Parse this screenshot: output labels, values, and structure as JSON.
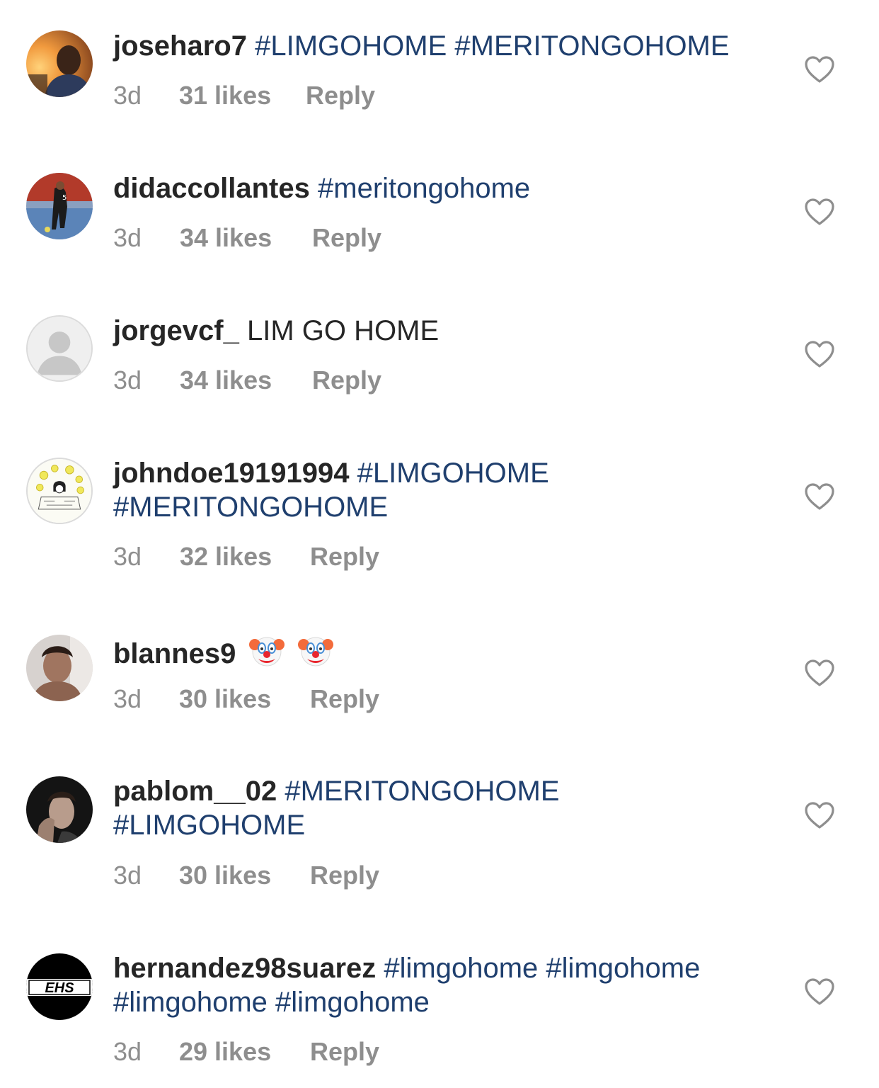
{
  "comments": [
    {
      "username": "joseharo7",
      "text_parts": [
        {
          "type": "hashtag",
          "text": "#LIMGOHOME"
        },
        {
          "type": "hashtag",
          "text": "#MERITONGOHOME"
        }
      ],
      "time": "3d",
      "likes": "31 likes",
      "reply": "Reply",
      "avatar": "avatar-sunset-portrait"
    },
    {
      "username": "didaccollantes",
      "text_parts": [
        {
          "type": "hashtag",
          "text": "#meritongohome"
        }
      ],
      "time": "3d",
      "likes": "34 likes",
      "reply": "Reply",
      "avatar": "avatar-futsal-player"
    },
    {
      "username": "jorgevcf_",
      "text_parts": [
        {
          "type": "plain",
          "text": "LIM GO HOME"
        }
      ],
      "time": "3d",
      "likes": "34 likes",
      "reply": "Reply",
      "avatar": "default-avatar-icon"
    },
    {
      "username": "johndoe19191994",
      "text_parts": [
        {
          "type": "hashtag",
          "text": "#LIMGOHOME"
        },
        {
          "type": "hashtag",
          "text": "#MERITONGOHOME"
        }
      ],
      "time": "3d",
      "likes": "32 likes",
      "reply": "Reply",
      "avatar": "avatar-drawing"
    },
    {
      "username": "blannes9",
      "text_parts": [
        {
          "type": "emoji",
          "icon": "clown-face-icon"
        },
        {
          "type": "emoji",
          "icon": "clown-face-icon"
        }
      ],
      "time": "3d",
      "likes": "30 likes",
      "reply": "Reply",
      "avatar": "avatar-selfie"
    },
    {
      "username": "pablom__02",
      "text_parts": [
        {
          "type": "hashtag",
          "text": "#MERITONGOHOME"
        },
        {
          "type": "hashtag",
          "text": "#LIMGOHOME"
        }
      ],
      "time": "3d",
      "likes": "30 likes",
      "reply": "Reply",
      "avatar": "avatar-dark-portrait"
    },
    {
      "username": "hernandez98suarez",
      "text_parts": [
        {
          "type": "hashtag",
          "text": "#limgohome"
        },
        {
          "type": "hashtag",
          "text": "#limgohome"
        },
        {
          "type": "hashtag",
          "text": "#limgohome"
        },
        {
          "type": "hashtag",
          "text": "#limgohome"
        }
      ],
      "time": "3d",
      "likes": "29 likes",
      "reply": "Reply",
      "avatar": "avatar-ehs-logo"
    }
  ],
  "logo_text": "EHS",
  "colors": {
    "text": "#262626",
    "hashtag": "#1f3f6e",
    "meta": "#8e8e8e",
    "heart_outline": "#8e8e8e"
  }
}
